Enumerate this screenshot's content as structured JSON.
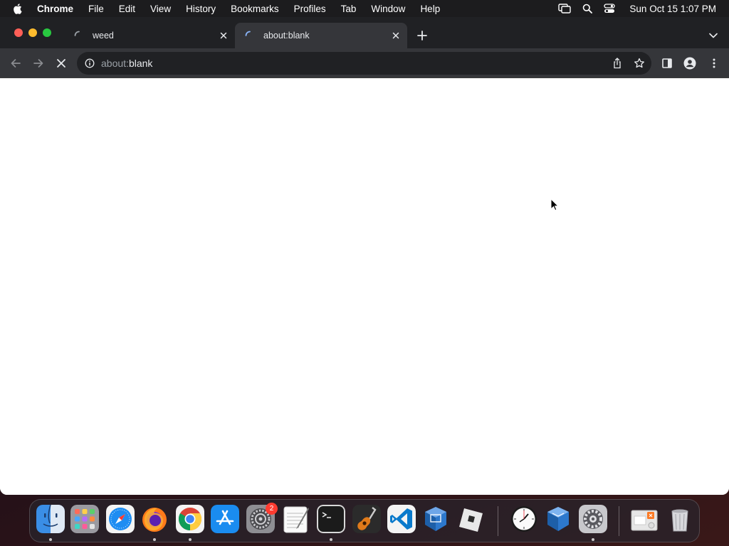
{
  "menubar": {
    "app_name": "Chrome",
    "items": [
      "File",
      "Edit",
      "View",
      "History",
      "Bookmarks",
      "Profiles",
      "Tab",
      "Window",
      "Help"
    ],
    "clock": "Sun Oct 15  1:07 PM"
  },
  "browser": {
    "tabs": [
      {
        "title": "weed",
        "loading": true,
        "active": false
      },
      {
        "title": "about:blank",
        "loading": true,
        "active": true
      }
    ],
    "omnibox": {
      "url_scheme": "about:",
      "url_rest": "blank"
    },
    "loading_state": "stop"
  },
  "dock": {
    "apps": [
      {
        "name": "finder-icon",
        "running": true
      },
      {
        "name": "launchpad-icon",
        "running": false
      },
      {
        "name": "safari-icon",
        "running": false
      },
      {
        "name": "firefox-icon",
        "running": true
      },
      {
        "name": "chrome-icon",
        "running": true
      },
      {
        "name": "app-store-icon",
        "running": false
      },
      {
        "name": "system-preferences-icon",
        "running": false,
        "badge": "2"
      },
      {
        "name": "textedit-icon",
        "running": false
      },
      {
        "name": "terminal-icon",
        "running": true
      },
      {
        "name": "garageband-icon",
        "running": false
      },
      {
        "name": "vscode-icon",
        "running": false
      },
      {
        "name": "virtualbox-icon",
        "running": false
      },
      {
        "name": "roblox-icon",
        "running": false
      },
      {
        "name": "clock-icon",
        "running": false
      },
      {
        "name": "virtualbox-vm-icon",
        "running": false
      },
      {
        "name": "system-settings-icon",
        "running": true
      },
      {
        "name": "xampp-folder-icon",
        "running": false
      },
      {
        "name": "trash-icon",
        "running": false
      }
    ]
  },
  "colors": {
    "chrome_dark": "#202124",
    "chrome_toolbar": "#35363a",
    "close_red": "#ff5f57",
    "minimize_yellow": "#febc2e",
    "zoom_green": "#28c840"
  }
}
